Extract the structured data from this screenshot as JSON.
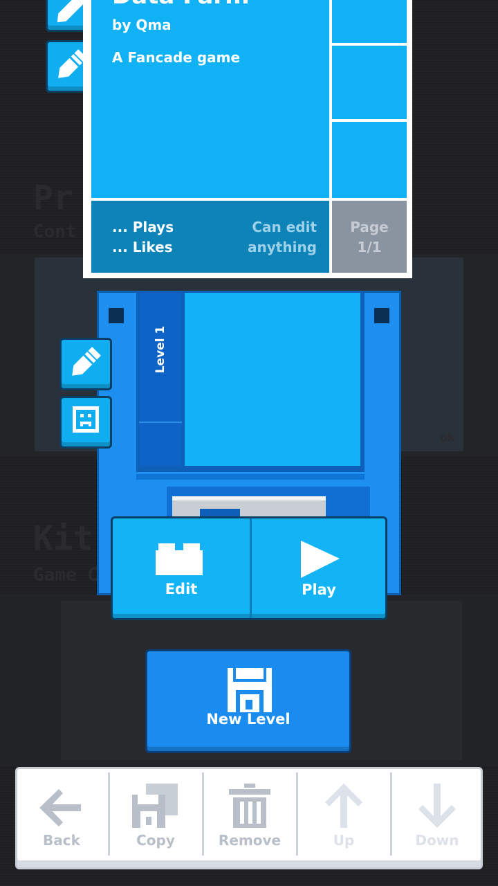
{
  "game": {
    "title": "Data Farm",
    "author": "by Qma",
    "subtitle": "A Fancade game",
    "plays": "... Plays",
    "likes": "... Likes",
    "edit_line1": "Can edit",
    "edit_line2": "anything",
    "page_label": "Page",
    "page_value": "1/1"
  },
  "level": {
    "label": "Level 1"
  },
  "actions": {
    "edit_label": "Edit",
    "play_label": "Play",
    "new_level_label": "New Level"
  },
  "toolbar": {
    "back_label": "Back",
    "copy_label": "Copy",
    "remove_label": "Remove",
    "up_label": "Up",
    "down_label": "Down"
  },
  "background": {
    "heading1": "Pr",
    "sub1": "Cont",
    "heading2": "Kit",
    "sub2": "Game C",
    "badge": "ok"
  },
  "colors": {
    "accent": "#0fb0f2",
    "accent_dark": "#0b7fc4",
    "floppy": "#1c8ff0",
    "background": "#1f1f22"
  }
}
